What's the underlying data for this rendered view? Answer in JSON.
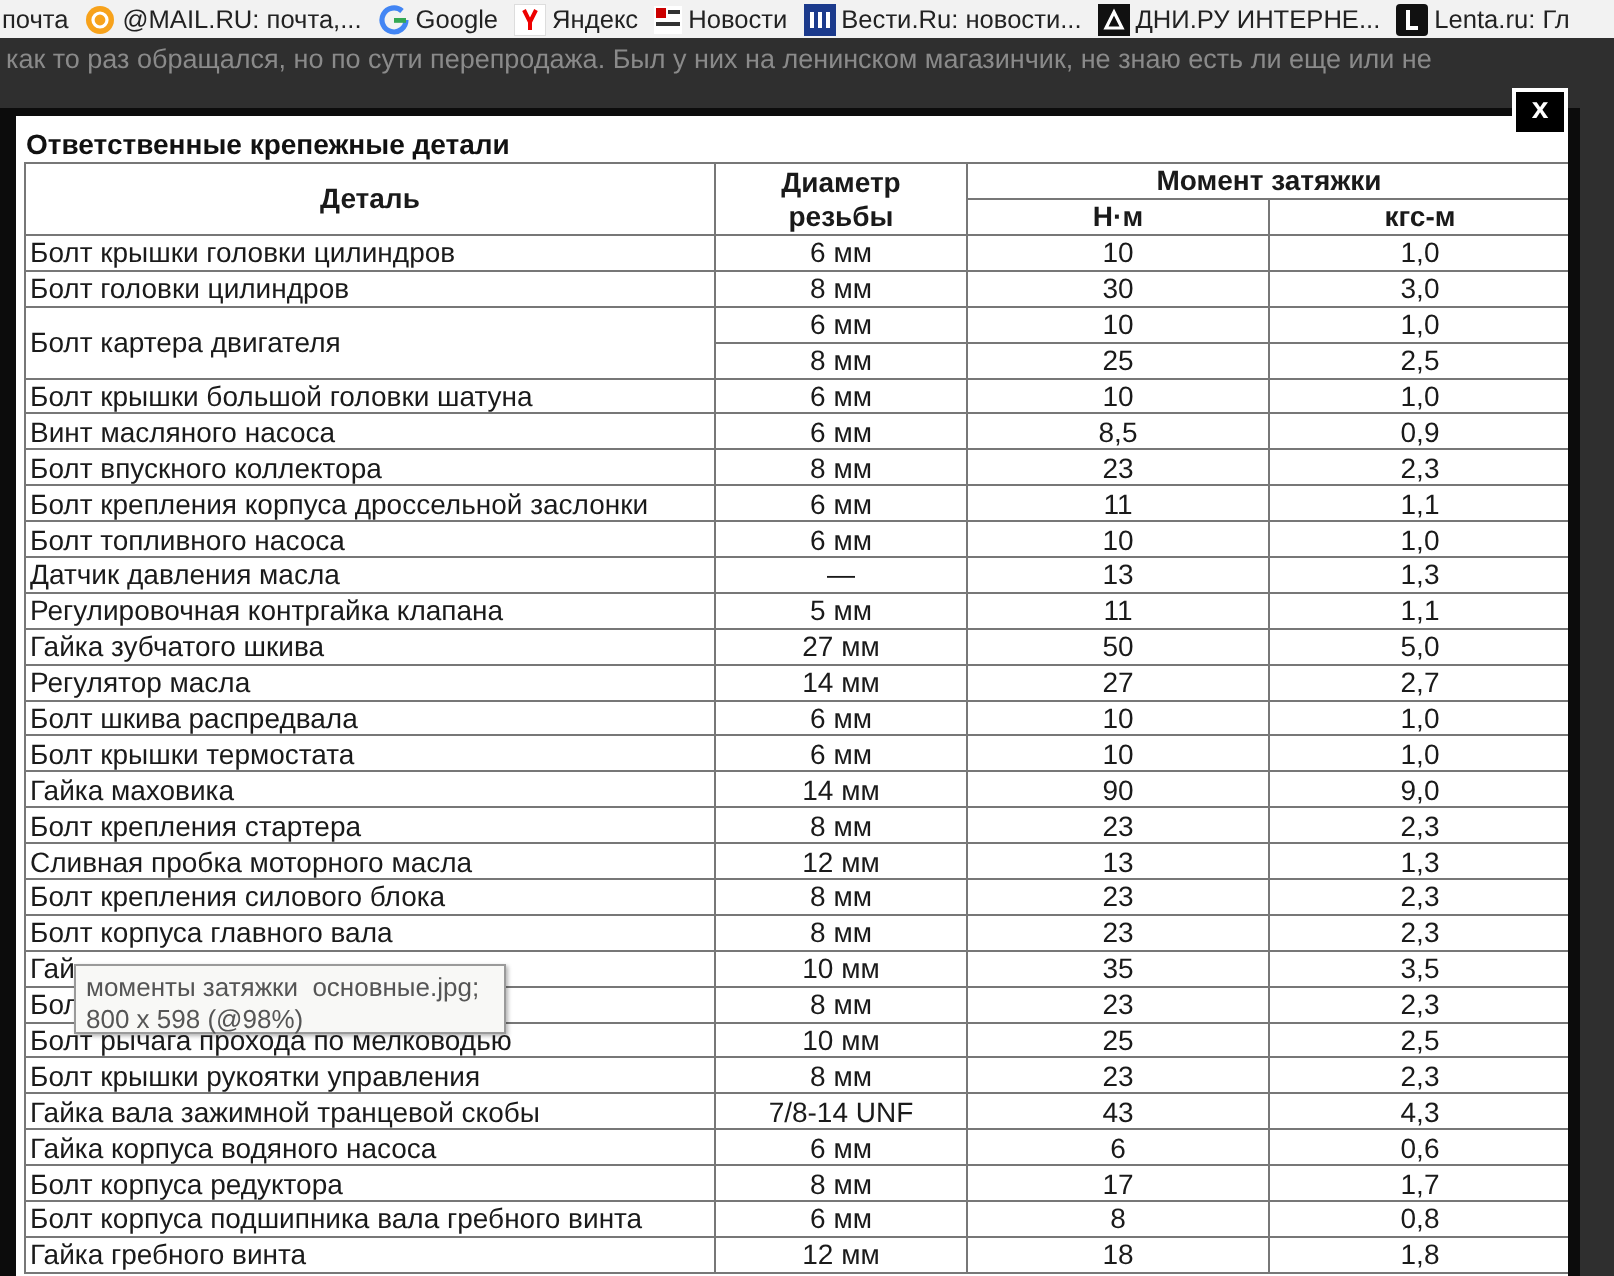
{
  "bookmarks": [
    {
      "label": "почта"
    },
    {
      "label": "@MAIL.RU: почта,..."
    },
    {
      "label": "Google"
    },
    {
      "label": "Яндекс"
    },
    {
      "label": "Новости"
    },
    {
      "label": "Вести.Ru: новости..."
    },
    {
      "label": "ДНИ.РУ ИНТЕРНЕ..."
    },
    {
      "label": "Lenta.ru: Гл"
    }
  ],
  "page_text": "как то раз обращался, но по сути перепродажа. Был у них на ленинском магазинчик, не знаю есть ли еще или не",
  "lightbox": {
    "close": "x",
    "table": {
      "title": "Ответственные крепежные детали",
      "columns": {
        "part": "Деталь",
        "diameter": "Диаметр резьбы",
        "torque": "Момент затяжки",
        "nm": "Н·м",
        "kgsm": "кгс-м"
      },
      "rows": [
        {
          "part": "Болт крышки головки цилиндров",
          "entries": [
            {
              "diameter": "6 мм",
              "nm": "10",
              "kgsm": "1,0"
            }
          ]
        },
        {
          "part": "Болт головки цилиндров",
          "entries": [
            {
              "diameter": "8 мм",
              "nm": "30",
              "kgsm": "3,0"
            }
          ]
        },
        {
          "part": "Болт картера двигателя",
          "entries": [
            {
              "diameter": "6 мм",
              "nm": "10",
              "kgsm": "1,0"
            },
            {
              "diameter": "8 мм",
              "nm": "25",
              "kgsm": "2,5"
            }
          ]
        },
        {
          "part": "Болт крышки большой головки шатуна",
          "entries": [
            {
              "diameter": "6 мм",
              "nm": "10",
              "kgsm": "1,0"
            }
          ]
        },
        {
          "part": "Винт масляного насоса",
          "entries": [
            {
              "diameter": "6 мм",
              "nm": "8,5",
              "kgsm": "0,9"
            }
          ]
        },
        {
          "part": "Болт впускного коллектора",
          "entries": [
            {
              "diameter": "8 мм",
              "nm": "23",
              "kgsm": "2,3"
            }
          ]
        },
        {
          "part": "Болт крепления корпуса дроссельной заслонки",
          "entries": [
            {
              "diameter": "6 мм",
              "nm": "11",
              "kgsm": "1,1"
            }
          ]
        },
        {
          "part": "Болт топливного насоса",
          "entries": [
            {
              "diameter": "6 мм",
              "nm": "10",
              "kgsm": "1,0"
            }
          ]
        },
        {
          "part": "Датчик давления масла",
          "entries": [
            {
              "diameter": "—",
              "nm": "13",
              "kgsm": "1,3"
            }
          ]
        },
        {
          "part": "Регулировочная контргайка клапана",
          "entries": [
            {
              "diameter": "5 мм",
              "nm": "11",
              "kgsm": "1,1"
            }
          ]
        },
        {
          "part": "Гайка зубчатого шкива",
          "entries": [
            {
              "diameter": "27 мм",
              "nm": "50",
              "kgsm": "5,0"
            }
          ]
        },
        {
          "part": "Регулятор масла",
          "entries": [
            {
              "diameter": "14 мм",
              "nm": "27",
              "kgsm": "2,7"
            }
          ]
        },
        {
          "part": "Болт шкива распредвала",
          "entries": [
            {
              "diameter": "6 мм",
              "nm": "10",
              "kgsm": "1,0"
            }
          ]
        },
        {
          "part": "Болт крышки термостата",
          "entries": [
            {
              "diameter": "6 мм",
              "nm": "10",
              "kgsm": "1,0"
            }
          ]
        },
        {
          "part": "Гайка маховика",
          "entries": [
            {
              "diameter": "14 мм",
              "nm": "90",
              "kgsm": "9,0"
            }
          ]
        },
        {
          "part": "Болт крепления стартера",
          "entries": [
            {
              "diameter": "8 мм",
              "nm": "23",
              "kgsm": "2,3"
            }
          ]
        },
        {
          "part": "Сливная пробка моторного масла",
          "entries": [
            {
              "diameter": "12 мм",
              "nm": "13",
              "kgsm": "1,3"
            }
          ]
        },
        {
          "part": "Болт крепления силового блока",
          "entries": [
            {
              "diameter": "8 мм",
              "nm": "23",
              "kgsm": "2,3"
            }
          ]
        },
        {
          "part": "Болт корпуса главного вала",
          "entries": [
            {
              "diameter": "8 мм",
              "nm": "23",
              "kgsm": "2,3"
            }
          ]
        },
        {
          "part": "Гай",
          "entries": [
            {
              "diameter": "10 мм",
              "nm": "35",
              "kgsm": "3,5"
            }
          ]
        },
        {
          "part": "Бол",
          "entries": [
            {
              "diameter": "8 мм",
              "nm": "23",
              "kgsm": "2,3"
            }
          ]
        },
        {
          "part": "Болт рычага прохода по мелководью",
          "entries": [
            {
              "diameter": "10 мм",
              "nm": "25",
              "kgsm": "2,5"
            }
          ]
        },
        {
          "part": "Болт крышки рукоятки управления",
          "entries": [
            {
              "diameter": "8 мм",
              "nm": "23",
              "kgsm": "2,3"
            }
          ]
        },
        {
          "part": "Гайка вала зажимной транцевой скобы",
          "entries": [
            {
              "diameter": "7/8-14 UNF",
              "nm": "43",
              "kgsm": "4,3"
            }
          ]
        },
        {
          "part": "Гайка корпуса водяного насоса",
          "entries": [
            {
              "diameter": "6 мм",
              "nm": "6",
              "kgsm": "0,6"
            }
          ]
        },
        {
          "part": "Болт корпуса редуктора",
          "entries": [
            {
              "diameter": "8 мм",
              "nm": "17",
              "kgsm": "1,7"
            }
          ]
        },
        {
          "part": "Болт корпуса подшипника вала гребного винта",
          "entries": [
            {
              "diameter": "6 мм",
              "nm": "8",
              "kgsm": "0,8"
            }
          ]
        },
        {
          "part": "Гайка гребного винта",
          "entries": [
            {
              "diameter": "12 мм",
              "nm": "18",
              "kgsm": "1,8"
            }
          ]
        }
      ]
    },
    "tooltip": [
      "моменты затяжки  основные.jpg;",
      "800 x 598 (@98%)"
    ]
  }
}
